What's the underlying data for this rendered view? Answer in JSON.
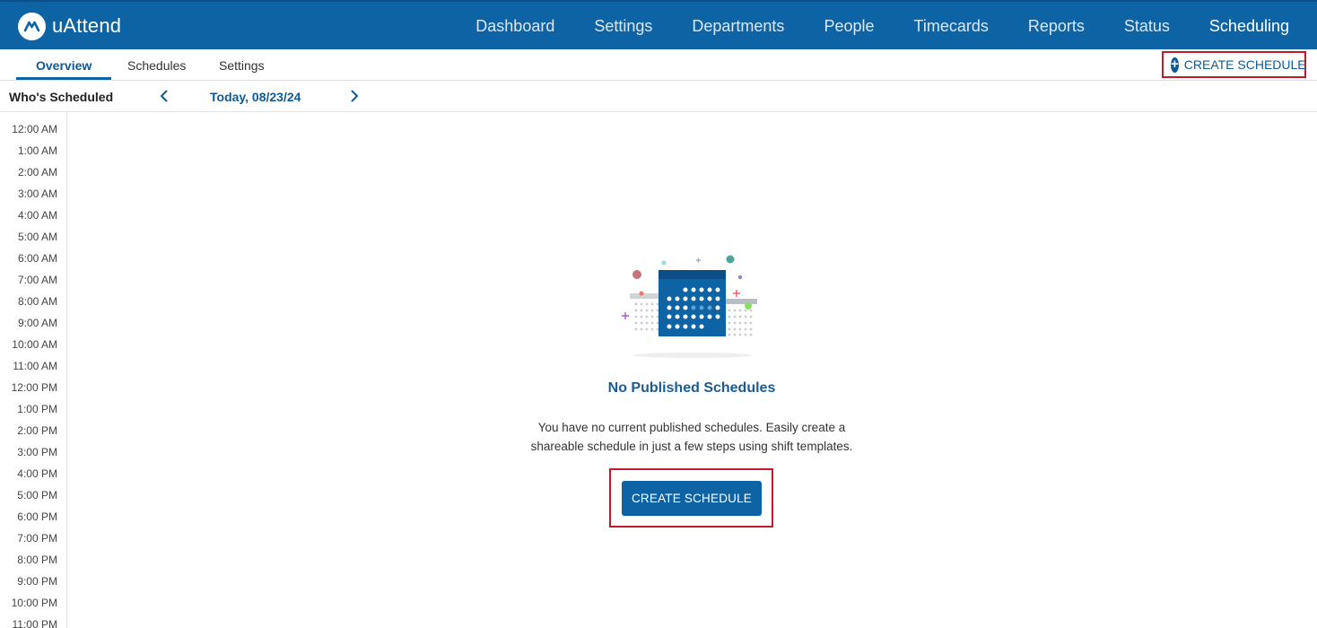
{
  "app": {
    "name": "uAttend"
  },
  "nav": {
    "items": [
      {
        "label": "Dashboard"
      },
      {
        "label": "Settings"
      },
      {
        "label": "Departments"
      },
      {
        "label": "People"
      },
      {
        "label": "Timecards"
      },
      {
        "label": "Reports"
      },
      {
        "label": "Status"
      },
      {
        "label": "Scheduling",
        "active": true
      }
    ]
  },
  "subnav": {
    "tabs": [
      {
        "label": "Overview",
        "active": true
      },
      {
        "label": "Schedules"
      },
      {
        "label": "Settings"
      }
    ],
    "create_label": "CREATE SCHEDULE"
  },
  "datebar": {
    "title": "Who's Scheduled",
    "date_label": "Today, 08/23/24"
  },
  "timeline": {
    "hours": [
      "12:00 AM",
      "1:00 AM",
      "2:00 AM",
      "3:00 AM",
      "4:00 AM",
      "5:00 AM",
      "6:00 AM",
      "7:00 AM",
      "8:00 AM",
      "9:00 AM",
      "10:00 AM",
      "11:00 AM",
      "12:00 PM",
      "1:00 PM",
      "2:00 PM",
      "3:00 PM",
      "4:00 PM",
      "5:00 PM",
      "6:00 PM",
      "7:00 PM",
      "8:00 PM",
      "9:00 PM",
      "10:00 PM",
      "11:00 PM"
    ]
  },
  "empty_state": {
    "title": "No Published Schedules",
    "line1": "You have no current published schedules. Easily create a",
    "line2": "shareable schedule in just a few steps using shift templates.",
    "button_label": "CREATE SCHEDULE",
    "icon": "calendar-illustration"
  },
  "colors": {
    "brand": "#0e63a5",
    "highlight": "#c01c28"
  }
}
